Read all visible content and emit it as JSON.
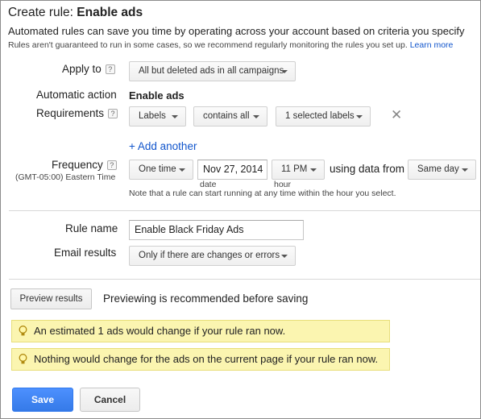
{
  "header": {
    "title_prefix": "Create rule: ",
    "title_bold": "Enable ads",
    "intro": "Automated rules can save you time by operating across your account based on criteria you specify",
    "note": "Rules aren't guaranteed to run in some cases, so we recommend regularly monitoring the rules you set up.",
    "learn_more": "Learn more"
  },
  "apply_to": {
    "label": "Apply to",
    "help": "?",
    "value": "All but deleted ads in all campaigns"
  },
  "automatic_action": {
    "label": "Automatic action",
    "value": "Enable ads"
  },
  "requirements": {
    "label": "Requirements",
    "help": "?",
    "field": "Labels",
    "operator": "contains all",
    "selection": "1 selected labels",
    "remove": "✕",
    "add_another": "+ Add another"
  },
  "frequency": {
    "label": "Frequency",
    "help": "?",
    "timezone": "(GMT-05:00) Eastern Time",
    "interval": "One time",
    "date": "Nov 27, 2014",
    "date_caption": "date",
    "time": "11 PM",
    "time_caption": "hour",
    "using_data_from": "using data from",
    "data_range": "Same day",
    "note": "Note that a rule can start running at any time within the hour you select."
  },
  "rule_name": {
    "label": "Rule name",
    "value": "Enable Black Friday Ads"
  },
  "email_results": {
    "label": "Email results",
    "value": "Only if there are changes or errors"
  },
  "preview": {
    "button": "Preview results",
    "hint": "Previewing is recommended before saving"
  },
  "banners": [
    "An estimated 1 ads would change if your rule ran now.",
    "Nothing would change for the ads on the current page if your rule ran now."
  ],
  "actions": {
    "save": "Save",
    "cancel": "Cancel"
  },
  "colors": {
    "accent": "#4d90fe",
    "link": "#1155cc",
    "banner_bg": "#fbf5b0"
  }
}
